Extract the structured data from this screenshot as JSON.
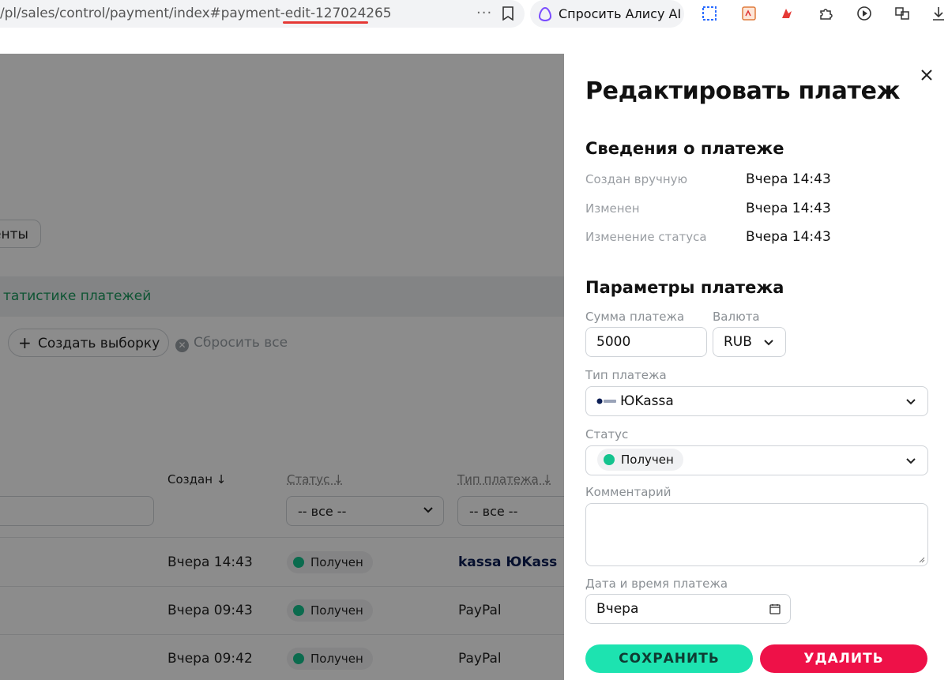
{
  "browser": {
    "url": "/pl/sales/control/payment/index#payment-edit-127024265",
    "url_more": "···",
    "alice_label": "Спросить Алису AI",
    "extensions": [
      "screenshot-icon",
      "pdf-icon",
      "paint-icon",
      "puzzle-icon",
      "media-icon",
      "translate-icon",
      "download-icon"
    ]
  },
  "background": {
    "segment_label": "енты",
    "stats_link": "татистике платежей",
    "create_selection": "Создать выборку",
    "reset_all": "Сбросить все",
    "columns": {
      "created": "Создан ↓",
      "status": "Статус ↓",
      "type": "Тип платежа ↓"
    },
    "filter_all_1": "-- все --",
    "filter_all_2": "-- все --",
    "rows": [
      {
        "date": "Вчера 14:43",
        "status": "Получен",
        "type": "kassa ЮKass"
      },
      {
        "date": "Вчера 09:43",
        "status": "Получен",
        "type": "PayPal"
      },
      {
        "date": "Вчера 09:42",
        "status": "Получен",
        "type": "PayPal"
      }
    ]
  },
  "drawer": {
    "title": "Редактировать платеж",
    "info_section": "Сведения о платеже",
    "info": [
      {
        "label": "Создан вручную",
        "value": "Вчера 14:43"
      },
      {
        "label": "Изменен",
        "value": "Вчера 14:43"
      },
      {
        "label": "Изменение статуса",
        "value": "Вчера 14:43"
      }
    ],
    "params_section": "Параметры платежа",
    "amount_label": "Сумма платежа",
    "amount_value": "5000",
    "currency_label": "Валюта",
    "currency_value": "RUB",
    "type_label": "Тип платежа",
    "type_value": "ЮKassa",
    "status_label": "Статус",
    "status_value": "Получен",
    "comment_label": "Комментарий",
    "datetime_label": "Дата и время платежа",
    "datetime_value": "Вчера",
    "save_label": "СОХРАНИТЬ",
    "delete_label": "УДАЛИТЬ"
  },
  "colors": {
    "accent_green": "#1de3b0",
    "danger_red": "#ee1148",
    "status_green": "#14c38e"
  }
}
